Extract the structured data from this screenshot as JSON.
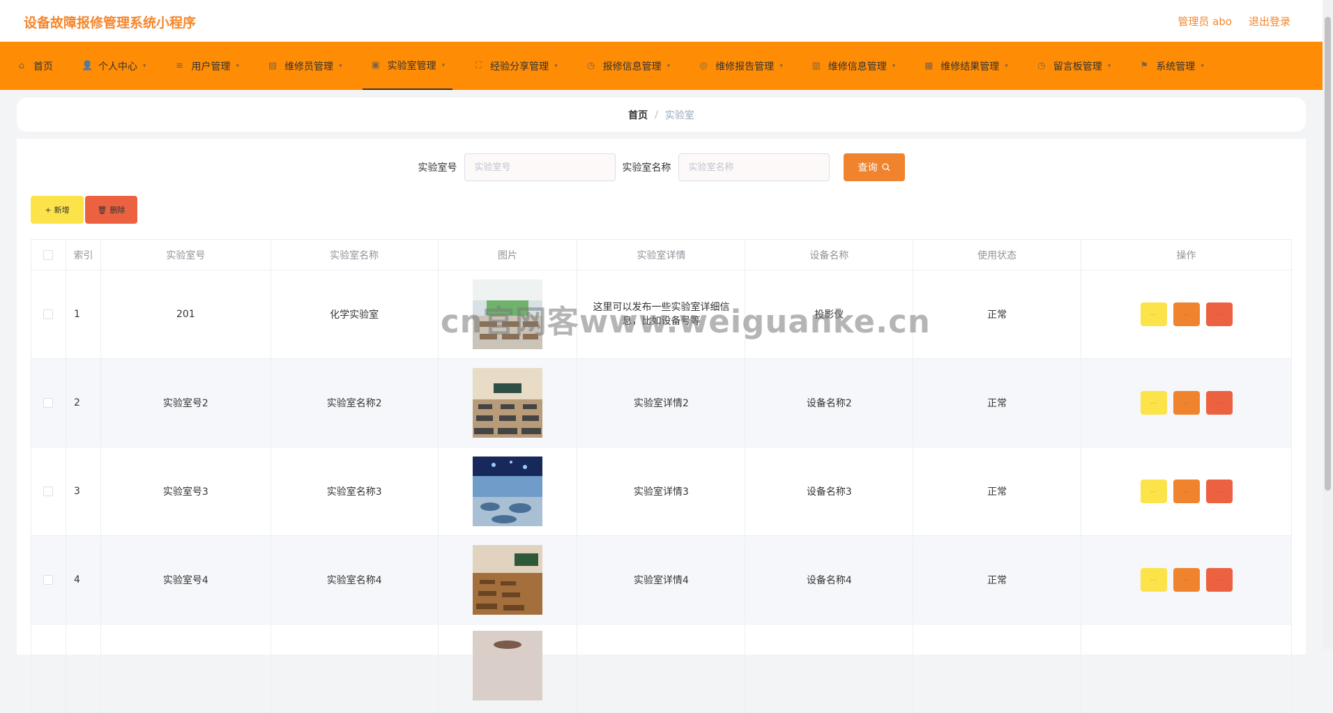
{
  "header": {
    "app_title": "设备故障报修管理系统小程序",
    "admin_label": "管理员 abo",
    "logout_label": "退出登录"
  },
  "nav": {
    "items": [
      {
        "label": "首页",
        "icon": "home-icon",
        "has_caret": false
      },
      {
        "label": "个人中心",
        "icon": "user-icon",
        "has_caret": true
      },
      {
        "label": "用户管理",
        "icon": "menu-icon",
        "has_caret": true
      },
      {
        "label": "维修员管理",
        "icon": "clipboard-icon",
        "has_caret": true
      },
      {
        "label": "实验室管理",
        "icon": "picture-icon",
        "has_caret": true
      },
      {
        "label": "经验分享管理",
        "icon": "fullscreen-icon",
        "has_caret": true
      },
      {
        "label": "报修信息管理",
        "icon": "clock-icon",
        "has_caret": true
      },
      {
        "label": "维修报告管理",
        "icon": "compass-icon",
        "has_caret": true
      },
      {
        "label": "维修信息管理",
        "icon": "briefcase-icon",
        "has_caret": true
      },
      {
        "label": "维修结果管理",
        "icon": "document-icon",
        "has_caret": true
      },
      {
        "label": "留言板管理",
        "icon": "clock-icon",
        "has_caret": true
      },
      {
        "label": "系统管理",
        "icon": "flag-icon",
        "has_caret": true
      }
    ],
    "active_index": 4
  },
  "breadcrumb": {
    "home": "首页",
    "separator": "/",
    "current": "实验室"
  },
  "search": {
    "field1_label": "实验室号",
    "field1_placeholder": "实验室号",
    "field2_label": "实验室名称",
    "field2_placeholder": "实验室名称",
    "query_label": "查询"
  },
  "toolbar": {
    "add_label": "新增",
    "delete_label": "删除"
  },
  "table": {
    "columns": [
      "索引",
      "实验室号",
      "实验室名称",
      "图片",
      "实验室详情",
      "设备名称",
      "使用状态",
      "操作"
    ],
    "rows": [
      {
        "index": "1",
        "lab_no": "201",
        "lab_name": "化学实验室",
        "detail": "这里可以发布一些实验室详细信息，比如设备号等",
        "device": "投影仪",
        "status": "正常",
        "image": "lab-photo-1"
      },
      {
        "index": "2",
        "lab_no": "实验室号2",
        "lab_name": "实验室名称2",
        "detail": "实验室详情2",
        "device": "设备名称2",
        "status": "正常",
        "image": "lab-photo-2"
      },
      {
        "index": "3",
        "lab_no": "实验室号3",
        "lab_name": "实验室名称3",
        "detail": "实验室详情3",
        "device": "设备名称3",
        "status": "正常",
        "image": "lab-photo-3"
      },
      {
        "index": "4",
        "lab_no": "实验室号4",
        "lab_name": "实验室名称4",
        "detail": "实验室详情4",
        "device": "设备名称4",
        "status": "正常",
        "image": "lab-photo-4"
      }
    ],
    "op_buttons": [
      "· ·",
      "· ·",
      "· ·"
    ]
  },
  "watermark": "cn官网客www.weiguanke.cn",
  "colors": {
    "accent": "#ff8c05",
    "title": "#f5862a",
    "yellow": "#fce34a",
    "orange": "#f0832d",
    "red": "#ec6140"
  }
}
